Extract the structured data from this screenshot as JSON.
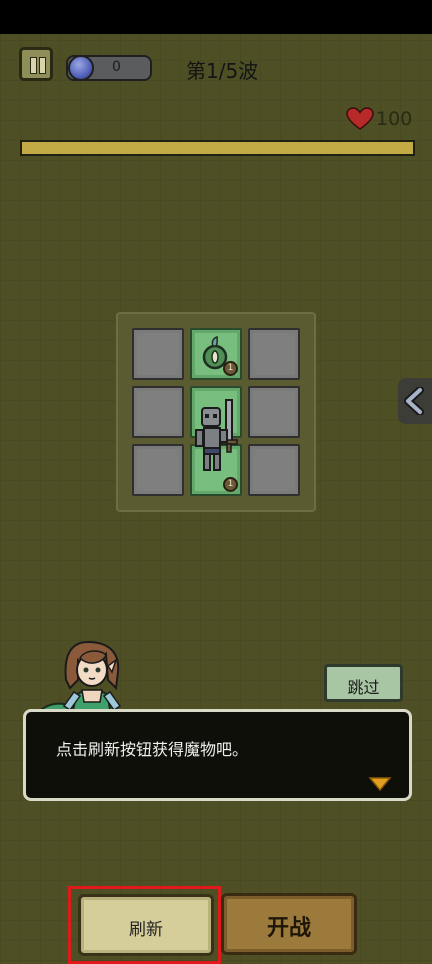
{
  "hud": {
    "coins": "0",
    "wave": "第1/5波",
    "hp": "100"
  },
  "board": {
    "cells": [
      {
        "active": false
      },
      {
        "active": true,
        "unit": "seed-creature",
        "level": "1"
      },
      {
        "active": false
      },
      {
        "active": false
      },
      {
        "active": true,
        "unit": "skeleton-warrior"
      },
      {
        "active": false
      },
      {
        "active": false
      },
      {
        "active": true,
        "level": "1"
      },
      {
        "active": false
      }
    ]
  },
  "tutorial": {
    "skip_label": "跳过",
    "message": "点击刷新按钮获得魔物吧。"
  },
  "actions": {
    "refresh_label": "刷新",
    "start_label": "开战"
  },
  "colors": {
    "background": "#4e4f24",
    "hp_bar": "#c2ab45",
    "highlight": "#e01a1a"
  }
}
